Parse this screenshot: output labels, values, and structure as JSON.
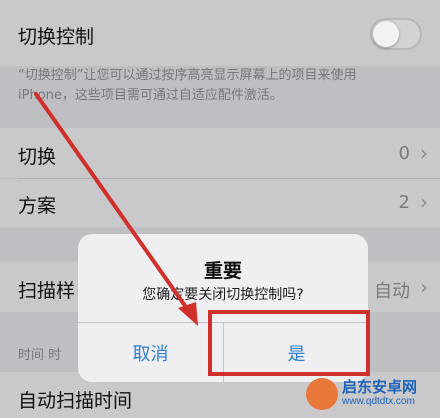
{
  "settings": {
    "switch_control_label": "切换控制",
    "footnote_line1": "“切换控制”让您可以通过按序高亮显示屏幕上的项目来使用",
    "footnote_line2": "iPhone，这些项目需可通过自适应配件激活。",
    "switches_label": "切换",
    "switches_value": "0",
    "recipes_label": "方案",
    "recipes_value": "2",
    "scan_style_label": "扫描样",
    "scan_style_value": "自动",
    "timing_header": "时间 时",
    "auto_scan_label": "自动扫描时间"
  },
  "dialog": {
    "title": "重要",
    "message": "您确定要关闭切换控制吗?",
    "cancel_label": "取消",
    "confirm_label": "是"
  },
  "watermark": {
    "name": "启东安卓网",
    "url": "www.qdtdtx.com"
  },
  "colors": {
    "annotation_red": "#d0302c",
    "dialog_button_blue": "#2f7fd6"
  }
}
